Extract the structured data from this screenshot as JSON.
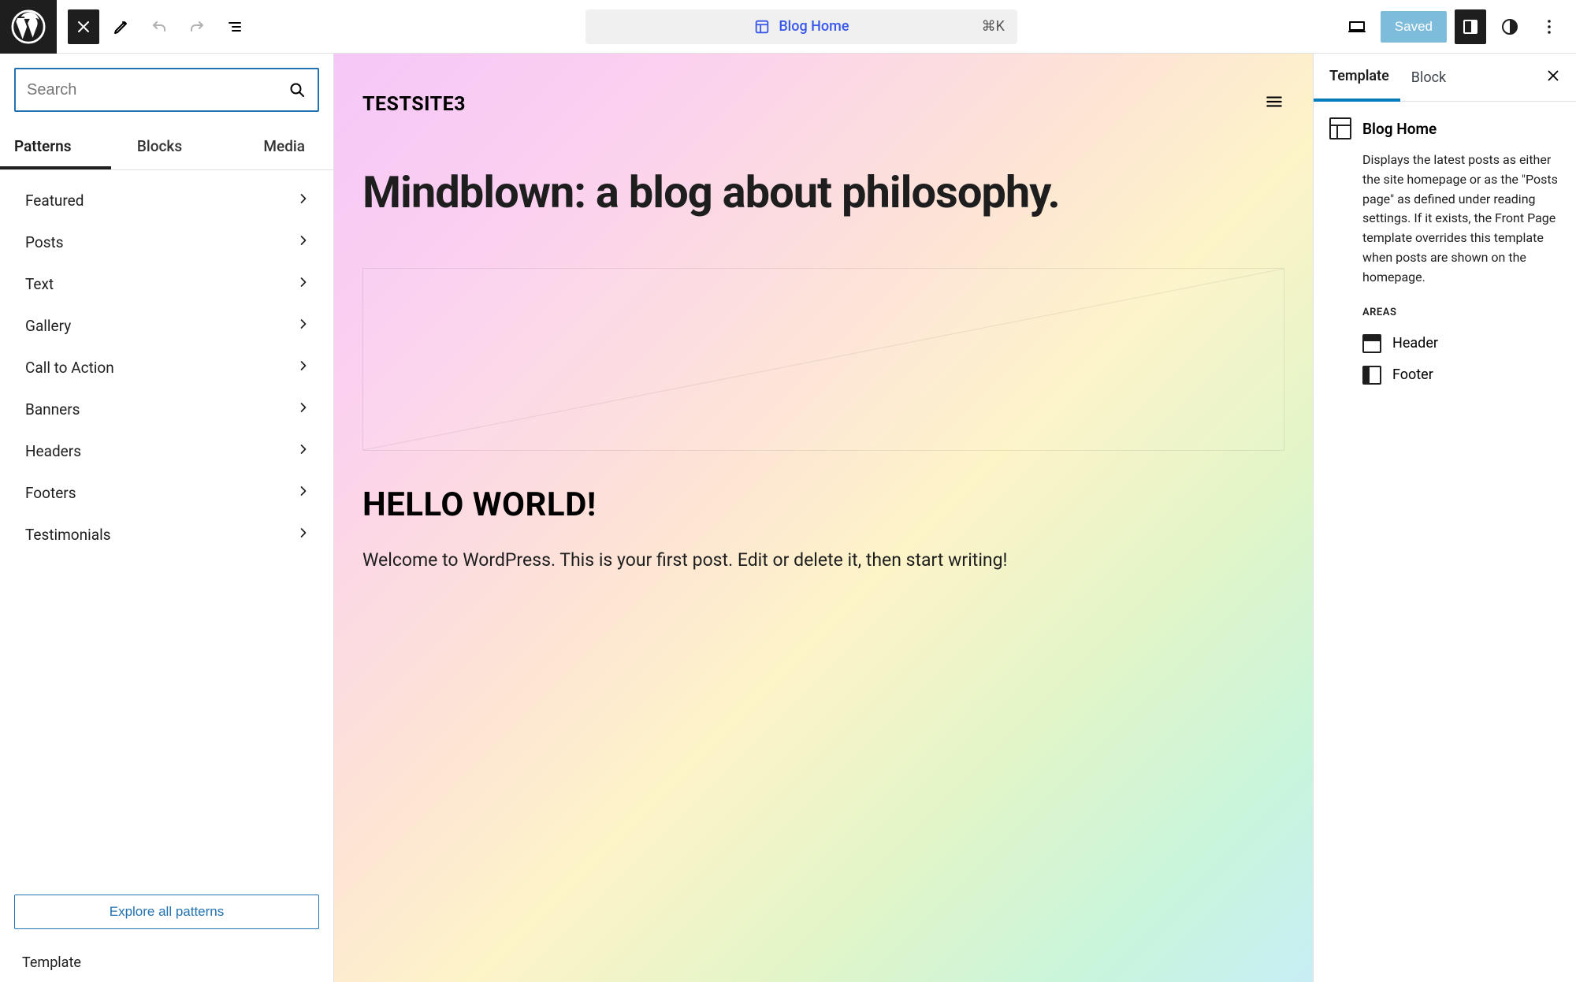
{
  "topbar": {
    "page_title": "Blog Home",
    "shortcut": "⌘K",
    "saved_label": "Saved"
  },
  "left": {
    "search_placeholder": "Search",
    "tabs": {
      "patterns": "Patterns",
      "blocks": "Blocks",
      "media": "Media"
    },
    "categories": [
      "Featured",
      "Posts",
      "Text",
      "Gallery",
      "Call to Action",
      "Banners",
      "Headers",
      "Footers",
      "Testimonials"
    ],
    "explore_label": "Explore all patterns",
    "footer_label": "Template"
  },
  "canvas": {
    "site_title": "TESTSITE3",
    "heading": "Mindblown: a blog about philosophy.",
    "post_title": "HELLO WORLD!",
    "post_body": "Welcome to WordPress. This is your first post. Edit or delete it, then start writing!"
  },
  "right": {
    "tabs": {
      "template": "Template",
      "block": "Block"
    },
    "template_title": "Blog Home",
    "template_desc": "Displays the latest posts as either the site homepage or as the \"Posts page\" as defined under reading settings. If it exists, the Front Page template overrides this template when posts are shown on the homepage.",
    "areas_label": "AREAS",
    "areas": [
      {
        "name": "Header",
        "icon": "header"
      },
      {
        "name": "Footer",
        "icon": "footer"
      }
    ]
  }
}
